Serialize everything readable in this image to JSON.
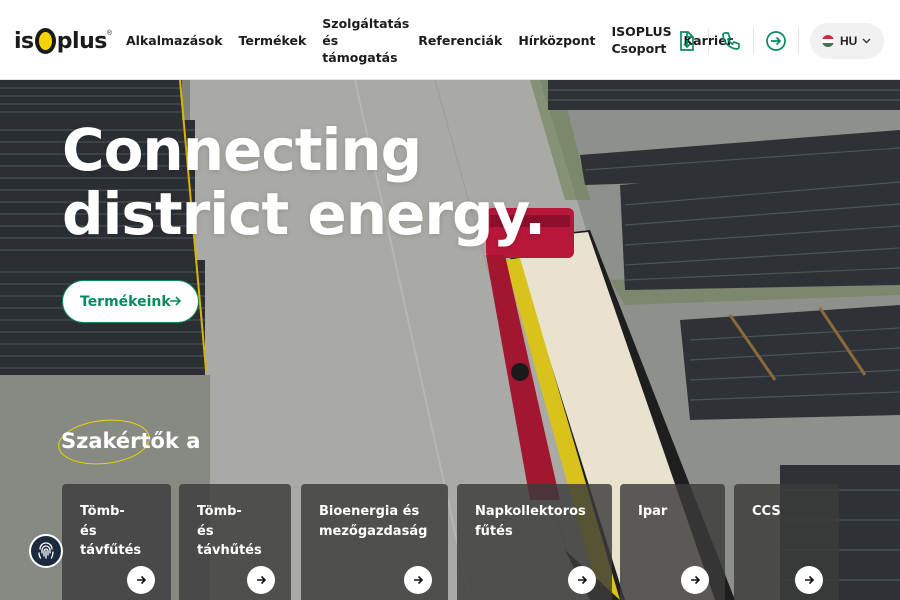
{
  "brand": {
    "logo_left": "is",
    "logo_right": "plus",
    "registered": "®"
  },
  "nav": {
    "items": [
      {
        "label": "Alkalmazások"
      },
      {
        "label": "Termékek"
      },
      {
        "label": "Szolgáltatás és támogatás"
      },
      {
        "label": "Referenciák"
      },
      {
        "label": "Hírközpont"
      },
      {
        "label": "ISOPLUS Csoport"
      },
      {
        "label": "Karrier"
      }
    ]
  },
  "header_icons": [
    "download-icon",
    "phone-icon",
    "login-icon",
    "search-icon"
  ],
  "language": {
    "code": "HU",
    "flag_colors": [
      "#ce2939",
      "#ffffff",
      "#477050"
    ]
  },
  "hero": {
    "title_line1": "Connecting",
    "title_line2": "district energy.",
    "cta_label": "Termékeink",
    "section_heading": "Szakértők a"
  },
  "cards": [
    {
      "label": "Tömb-\nés\ntávfűtés"
    },
    {
      "label": "Tömb-\nés\ntávhűtés"
    },
    {
      "label": "Bioenergia és mezőgazdaság"
    },
    {
      "label": "Napkollektoros fűtés"
    },
    {
      "label": "Ipar"
    },
    {
      "label": "CCS"
    }
  ],
  "colors": {
    "accent_green": "#0b8a5f",
    "brand_yellow": "#f2d400",
    "highlight_ring": "#f0d500"
  }
}
